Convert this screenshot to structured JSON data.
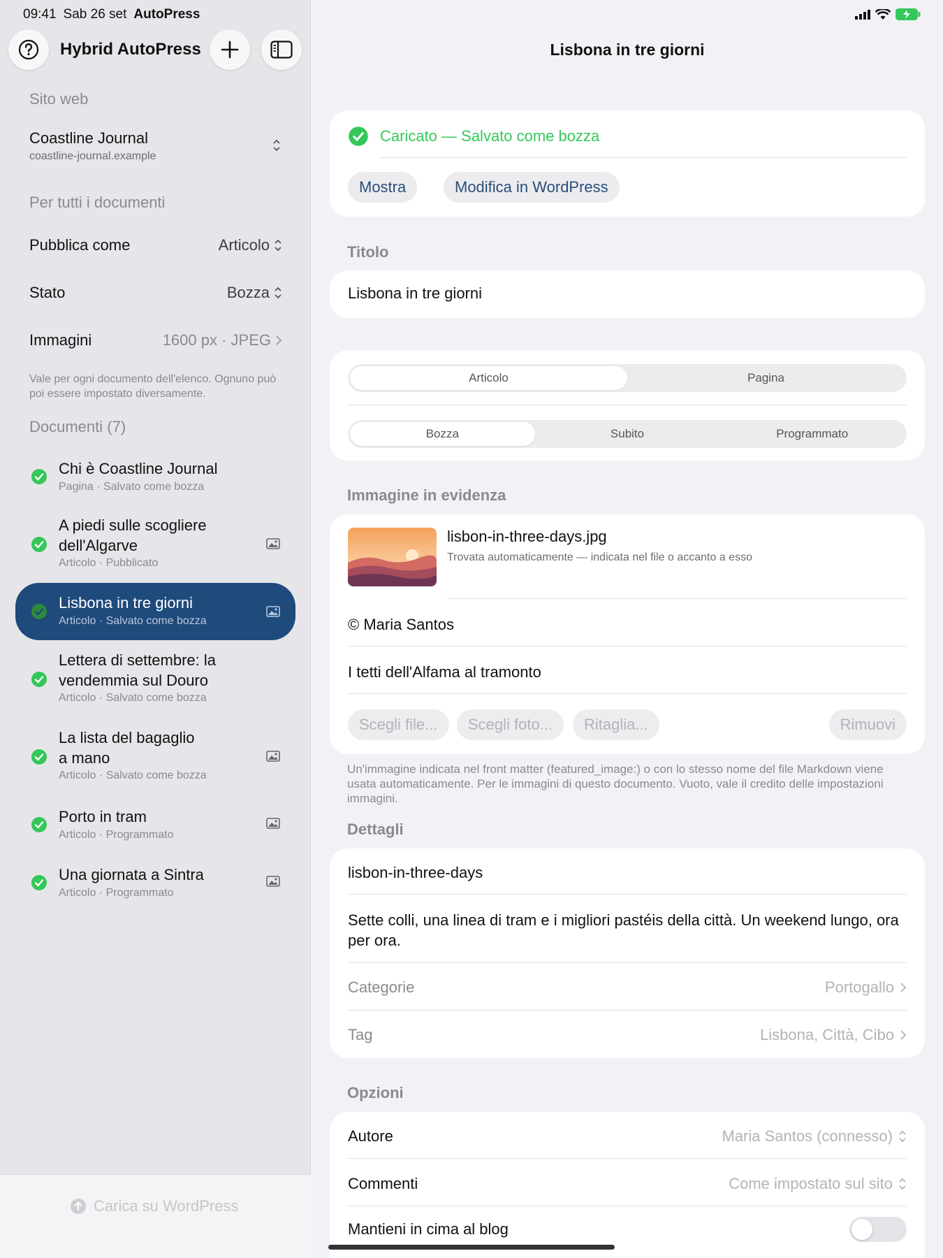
{
  "status": {
    "time": "09:41",
    "date": "Sab 26 set",
    "app": "AutoPress"
  },
  "sidebar": {
    "title": "Hybrid AutoPress",
    "site_label": "Sito web",
    "site_name": "Coastline Journal",
    "site_url": "coastline-journal.example",
    "all_docs_label": "Per tutti i documenti",
    "publish_as_label": "Pubblica come",
    "publish_as_value": "Articolo",
    "state_label": "Stato",
    "state_value": "Bozza",
    "images_label": "Immagini",
    "images_value": "1600 px · JPEG",
    "note": "Vale per ogni documento dell'elenco. Ognuno può poi essere impostato diversamente.",
    "docs_label": "Documenti (7)",
    "documents": [
      {
        "title": "Chi è Coastline Journal",
        "subtitle": "Pagina · Salvato come bozza"
      },
      {
        "title": "A piedi sulle scogliere dell'Algarve",
        "subtitle": "Articolo · Pubblicato"
      },
      {
        "title": "Lisbona in tre giorni",
        "subtitle": "Articolo · Salvato come bozza"
      },
      {
        "title": "Lettera di settembre: la vendemmia sul Douro",
        "subtitle": "Articolo · Salvato come bozza"
      },
      {
        "title": "La lista del bagaglio a mano",
        "subtitle": "Articolo · Salvato come bozza"
      },
      {
        "title": "Porto in tram",
        "subtitle": "Articolo · Programmato"
      },
      {
        "title": "Una giornata a Sintra",
        "subtitle": "Articolo · Programmato"
      }
    ],
    "upload_label": "Carica su WordPress"
  },
  "main": {
    "title": "Lisbona in tre giorni",
    "upload_status": "Caricato — Salvato come bozza",
    "show_button": "Mostra",
    "edit_button": "Modifica in WordPress",
    "title_label": "Titolo",
    "title_value": "Lisbona in tre giorni",
    "type_options": [
      "Articolo",
      "Pagina"
    ],
    "schedule_options": [
      "Bozza",
      "Subito",
      "Programmato"
    ],
    "featured_label": "Immagine in evidenza",
    "featured_file": "lisbon-in-three-days.jpg",
    "featured_desc": "Trovata automaticamente — indicata nel file o accanto a esso",
    "credit": "© Maria Santos",
    "caption": "I tetti dell'Alfama al tramonto",
    "choose_file": "Scegli file...",
    "choose_photo": "Scegli foto...",
    "crop": "Ritaglia...",
    "remove": "Rimuovi",
    "featured_note": "Un'immagine indicata nel front matter (featured_image:) o con lo stesso nome del file Markdown viene usata automaticamente. Per le immagini di questo documento. Vuoto, vale il credito delle impostazioni immagini.",
    "details_label": "Dettagli",
    "slug": "lisbon-in-three-days",
    "excerpt": "Sette colli, una linea di tram e i migliori pastéis della città. Un weekend lungo, ora per ora.",
    "categories_label": "Categorie",
    "categories_value": "Portogallo",
    "tags_label": "Tag",
    "tags_value": "Lisbona, Città, Cibo",
    "options_label": "Opzioni",
    "author_label": "Autore",
    "author_value": "Maria Santos (connesso)",
    "comments_label": "Commenti",
    "comments_value": "Come impostato sul sito",
    "sticky_label": "Mantieni in cima al blog"
  },
  "colors": {
    "accent": "#1f4a7c",
    "success": "#34c759",
    "link": "#2a4e78"
  }
}
